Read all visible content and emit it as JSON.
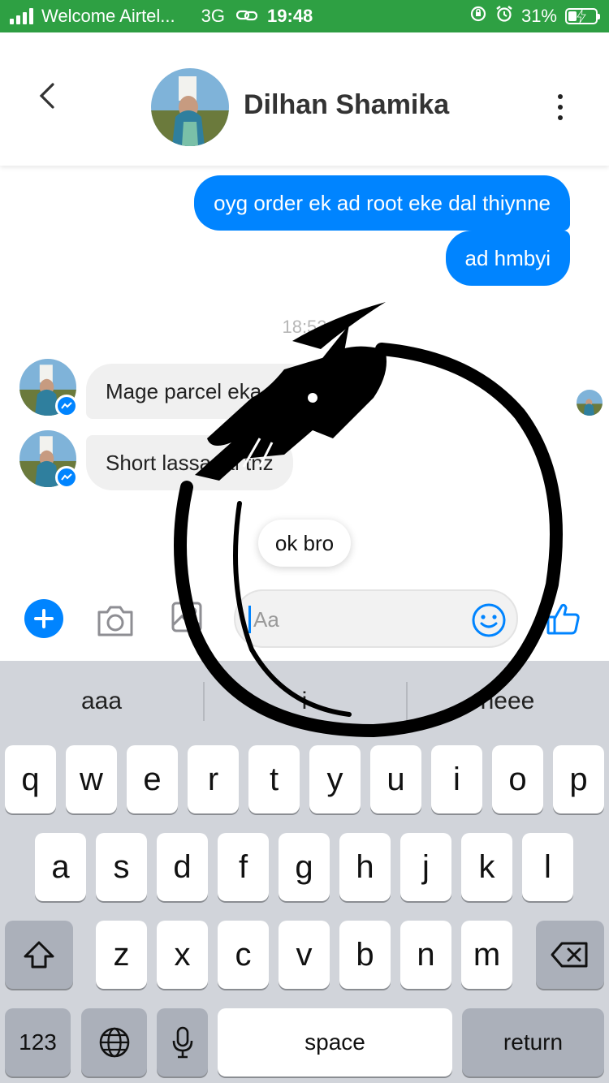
{
  "status_bar": {
    "carrier": "Welcome Airtel...",
    "network": "3G",
    "time": "19:48",
    "battery": "31%",
    "battery_level": 0.31,
    "bar_color": "#2ea043"
  },
  "header": {
    "contact_name": "Dilhan Shamika",
    "icons": [
      "chevron-left-icon",
      "more-vertical-icon"
    ]
  },
  "conversation": {
    "timestamp": "18:52",
    "outgoing": [
      {
        "text": "oyg order ek ad root eke dal thiynne"
      },
      {
        "text": "ad hmbyi"
      }
    ],
    "incoming": [
      {
        "text": "Mage parcel eka tnz"
      },
      {
        "text": "Short lassanai tnz"
      }
    ],
    "quick_reply": "ok bro",
    "accent_color": "#0084ff"
  },
  "composer": {
    "placeholder": "Aa",
    "icons": [
      "plus-icon",
      "camera-icon",
      "image-icon",
      "emoji-icon",
      "thumbs-up-icon"
    ]
  },
  "keyboard": {
    "suggestions": [
      "aaa",
      "i",
      "neee"
    ],
    "row1": [
      "q",
      "w",
      "e",
      "r",
      "t",
      "y",
      "u",
      "i",
      "o",
      "p"
    ],
    "row2": [
      "a",
      "s",
      "d",
      "f",
      "g",
      "h",
      "j",
      "k",
      "l"
    ],
    "row3": [
      "z",
      "x",
      "c",
      "v",
      "b",
      "n",
      "m"
    ],
    "numbers_label": "123",
    "space_label": "space",
    "return_label": "return"
  }
}
